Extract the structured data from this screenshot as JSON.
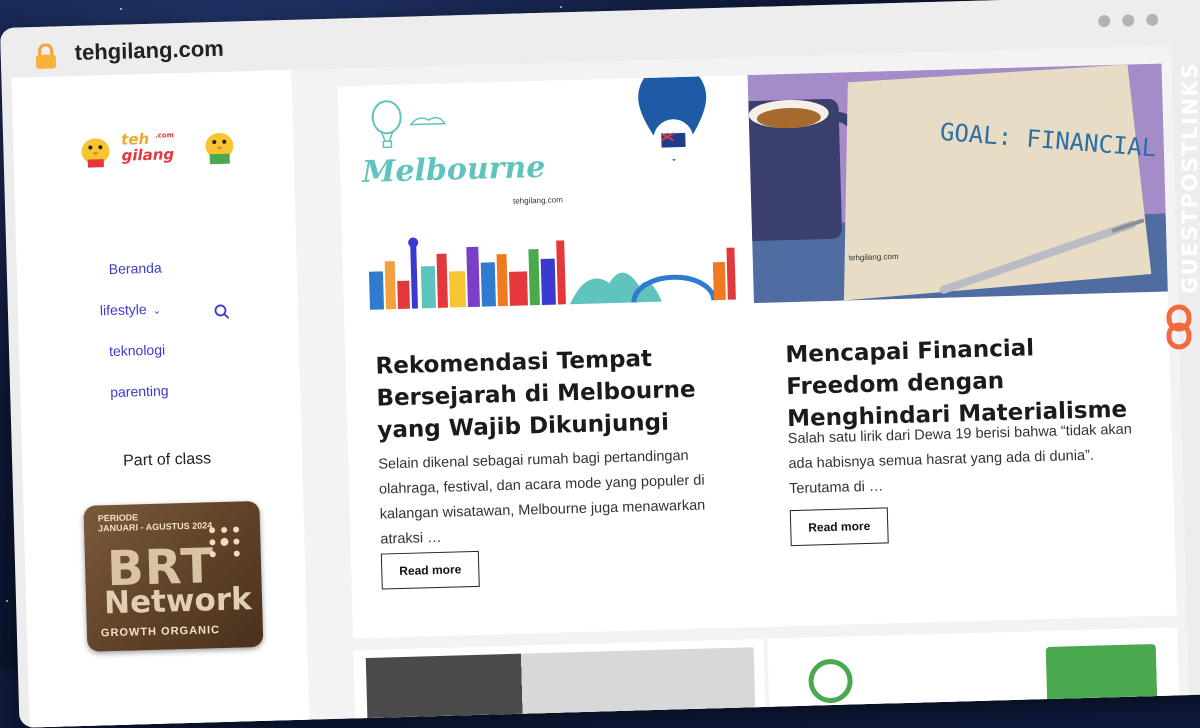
{
  "browser": {
    "url": "tehgilang.com"
  },
  "sidebar": {
    "logo_top": "teh",
    "logo_com": ".com",
    "logo_bottom": "gilang",
    "nav": [
      {
        "label": "Beranda"
      },
      {
        "label": "lifestyle"
      },
      {
        "label": "teknologi"
      },
      {
        "label": "parenting"
      }
    ],
    "part_of_class": "Part of class",
    "badge": {
      "period_label": "PERIODE",
      "period": "JANUARI - AGUSTUS 2024",
      "brt": "BRT",
      "network": "Network",
      "tagline": "GROWTH ORGANIC"
    }
  },
  "posts": [
    {
      "thumb_text": "Melbourne",
      "watermark": "tehgilang.com",
      "title": "Rekomendasi Tempat Bersejarah di Melbourne yang Wajib Dikunjungi",
      "excerpt": "Selain dikenal sebagai rumah bagi pertandingan olahraga, festival, dan acara mode yang populer di kalangan wisatawan, Melbourne juga menawarkan atraksi …",
      "button": "Read more"
    },
    {
      "thumb_text": "GOAL: FINANCIAL FREEDOM",
      "watermark": "tehgilang.com",
      "title": "Mencapai Financial Freedom dengan Menghindari Materialisme",
      "excerpt": "Salah satu lirik dari Dewa 19 berisi bahwa “tidak akan ada habisnya semua hasrat yang ada di dunia”. Terutama di …",
      "button": "Read more"
    }
  ],
  "overlay": {
    "brand": "GUESTPOSTLINKS"
  },
  "colors": {
    "nav_link": "#3a3ad0",
    "background": "#0e1a3a",
    "brand_orange": "#f26a3d"
  }
}
